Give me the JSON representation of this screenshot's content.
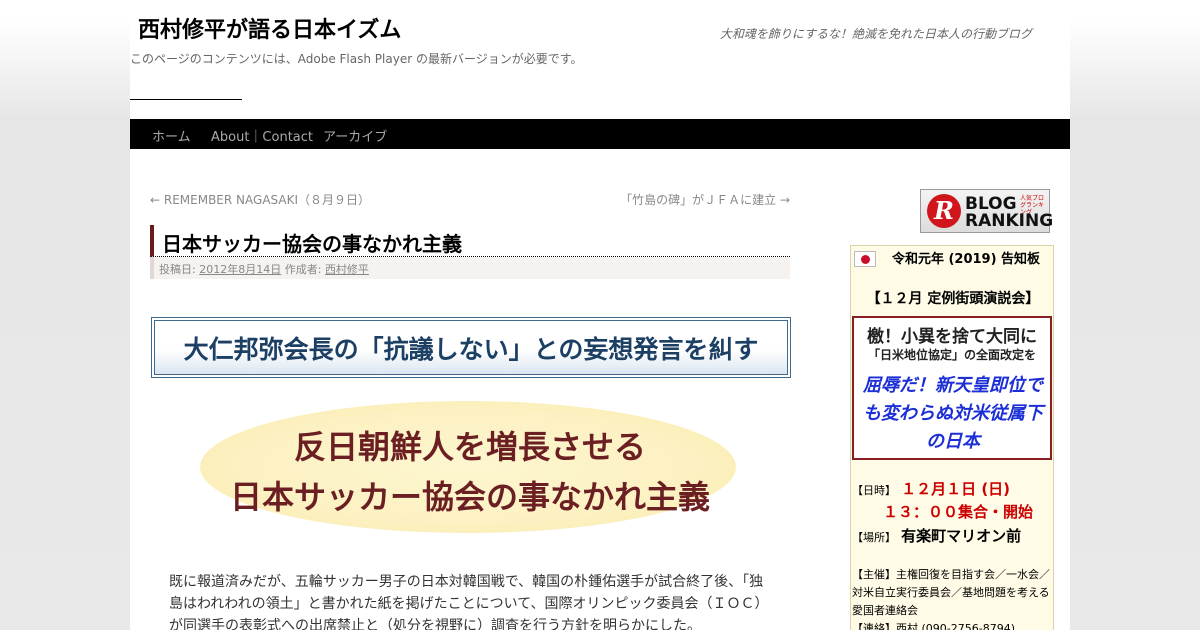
{
  "header": {
    "site_title": "西村修平が語る日本イズム",
    "site_description": "大和魂を飾りにするな！絶滅を免れた日本人の行動ブログ",
    "flash_note": "このページのコンテンツには、Adobe Flash Player の最新バージョンが必要です。"
  },
  "nav": {
    "items": [
      {
        "label": "ホーム"
      },
      {
        "label": "About｜Contact"
      },
      {
        "label": "アーカイブ"
      }
    ]
  },
  "post_nav": {
    "previous": "← REMEMBER NAGASAKI（８月９日）",
    "next": "「竹島の碑」がＪＦＡに建立 →"
  },
  "entry": {
    "title": "日本サッカー協会の事なかれ主義",
    "meta_posted_label": "投稿日:",
    "meta_date": "2012年8月14日",
    "meta_author_label": "作成者:",
    "meta_author": "西村修平",
    "banner_text": "大仁邦弥会長の「抗議しない」との妄想発言を糾す",
    "headline_line1": "反日朝鮮人を増長させる",
    "headline_line2": "日本サッカー協会の事なかれ主義",
    "body_line1": "既に報道済みだが、五輪サッカー男子の日本対韓国戦で、韓国の朴鍾佑選手が試合終了後、「独",
    "body_line2": "島はわれわれの領土」と書かれた紙を掲げたことについて、国際オリンピック委員会（ＩＯＣ）",
    "body_line3": "が同選手の表彰式への出席禁止と（処分を視野に）調査を行う方針を明らかにした。"
  },
  "sidebar": {
    "ranking": {
      "line1": "BLOG",
      "line2": "RANKING",
      "small": "人気ブログランキング",
      "logo_letter": "R"
    },
    "notice": {
      "header": "令和元年 (2019) 告知板",
      "event": "【１２月 定例街頭演説会】",
      "slogan1": "檄！小異を捨て大同に",
      "slogan2": "「日米地位協定」の全面改定を",
      "slogan3": "屈辱だ！新天皇即位でも変わらぬ対米従属下の日本",
      "date_label": "【日時】",
      "date_value": "１２月１日 (日)",
      "time_value": "１３：００集合・開始",
      "place_label": "【場所】",
      "place_value": "有楽町マリオン前",
      "sponsor": "【主催】主権回復を目指す会／一水会／対米自立実行委員会／基地問題を考える愛国者連絡会",
      "contact": "【連絡】西村 (090-2756-8794)"
    }
  }
}
